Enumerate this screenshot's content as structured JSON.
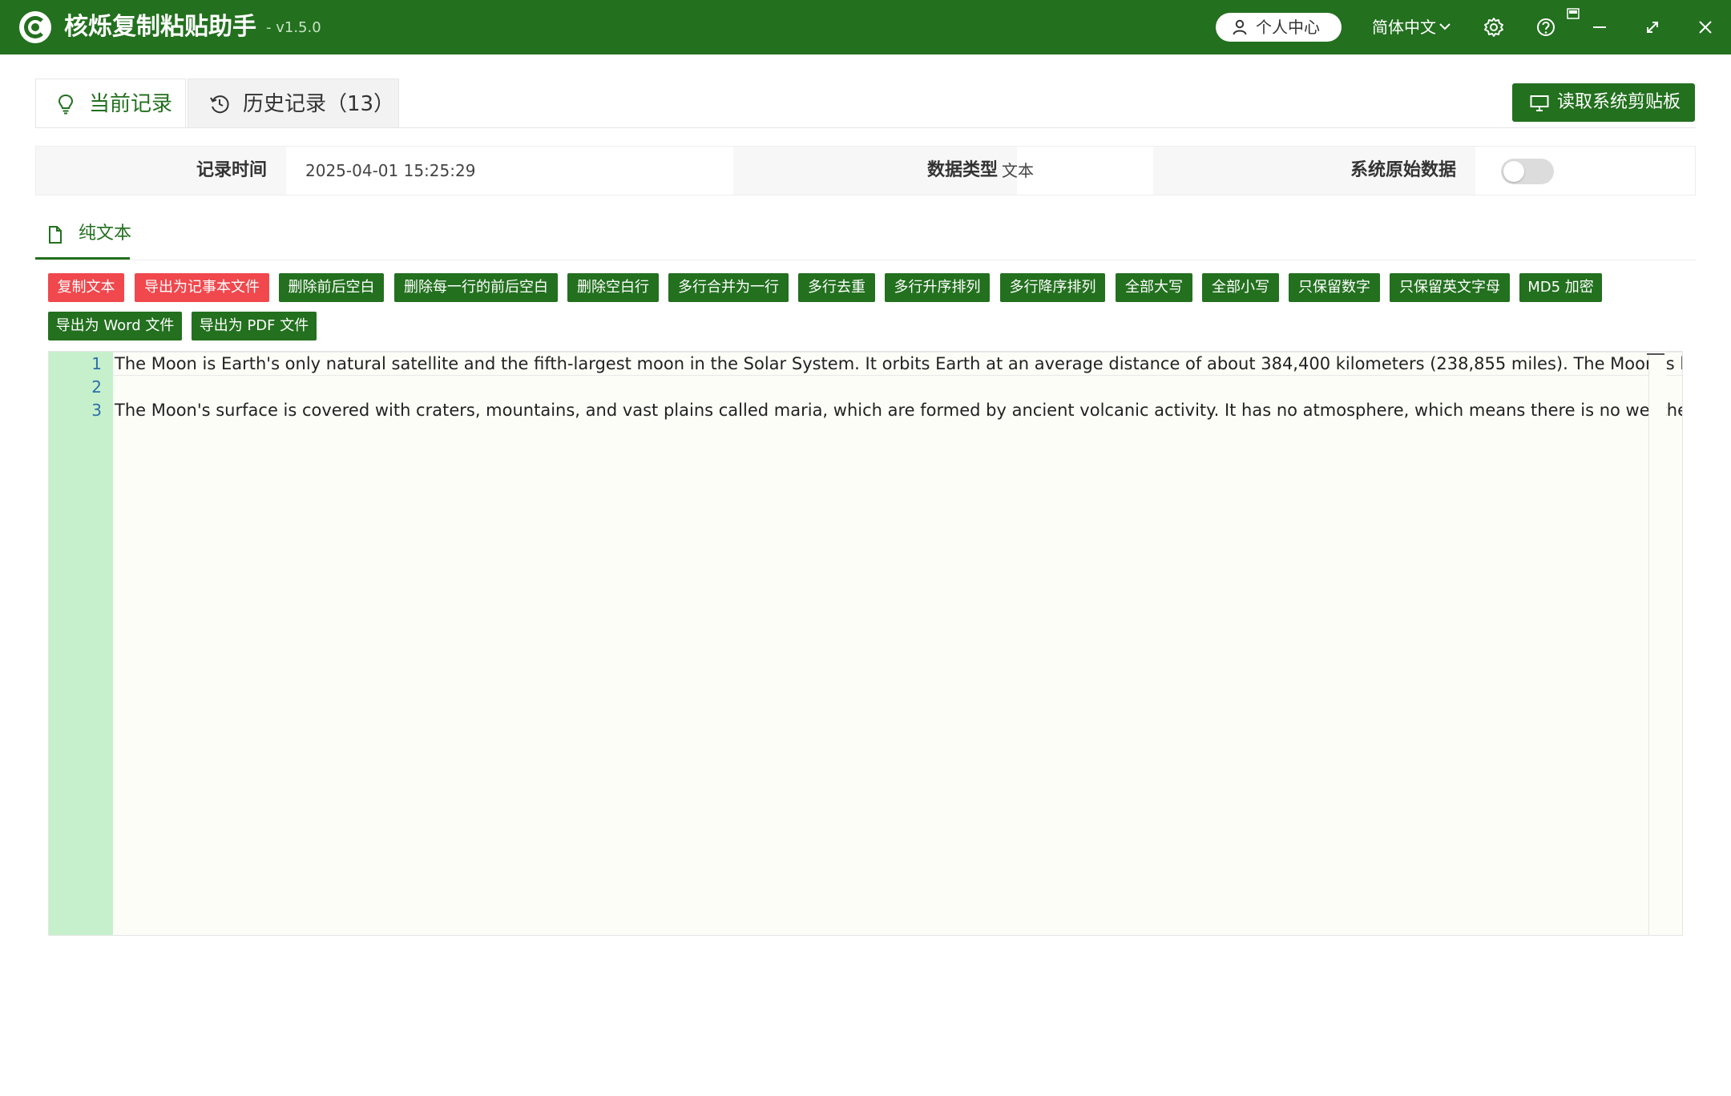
{
  "app": {
    "title": "核烁复制粘贴助手",
    "version": "- v1.5.0",
    "user_center": "个人中心",
    "language": "简体中文",
    "brand_color": "#23701f"
  },
  "toolbar": {
    "read_clipboard": "读取系统剪贴板"
  },
  "tabs": [
    {
      "label": "当前记录",
      "icon": "lightbulb-icon",
      "active": true
    },
    {
      "label": "历史记录（13）",
      "icon": "history-clock-icon",
      "active": false
    }
  ],
  "info": {
    "record_time_label": "记录时间",
    "record_time_value": "2025-04-01 15:25:29",
    "data_type_label": "数据类型",
    "data_type_value": "文本",
    "raw_data_label": "系统原始数据",
    "raw_data_enabled": false
  },
  "subtab": {
    "label": "纯文本",
    "icon": "document-icon"
  },
  "actions": [
    {
      "label": "复制文本",
      "variant": "red"
    },
    {
      "label": "导出为记事本文件",
      "variant": "red"
    },
    {
      "label": "删除前后空白",
      "variant": "green"
    },
    {
      "label": "删除每一行的前后空白",
      "variant": "green"
    },
    {
      "label": "删除空白行",
      "variant": "green"
    },
    {
      "label": "多行合并为一行",
      "variant": "green"
    },
    {
      "label": "多行去重",
      "variant": "green"
    },
    {
      "label": "多行升序排列",
      "variant": "green"
    },
    {
      "label": "多行降序排列",
      "variant": "green"
    },
    {
      "label": "全部大写",
      "variant": "green"
    },
    {
      "label": "全部小写",
      "variant": "green"
    },
    {
      "label": "只保留数字",
      "variant": "green"
    },
    {
      "label": "只保留英文字母",
      "variant": "green"
    },
    {
      "label": "MD5 加密",
      "variant": "green"
    },
    {
      "label": "导出为 Word 文件",
      "variant": "green"
    },
    {
      "label": "导出为 PDF 文件",
      "variant": "green"
    }
  ],
  "editor": {
    "lines": [
      {
        "number": "1",
        "text": "The Moon is Earth's only natural satellite and the fifth-largest moon in the Solar System. It orbits Earth at an average distance of about 384,400 kilometers (238,855 miles). The Moon is believed to"
      },
      {
        "number": "2",
        "text": ""
      },
      {
        "number": "3",
        "text": "The Moon's surface is covered with craters, mountains, and vast plains called maria, which are formed by ancient volcanic activity. It has no atmosphere, which means there is no weather or sound."
      }
    ]
  }
}
